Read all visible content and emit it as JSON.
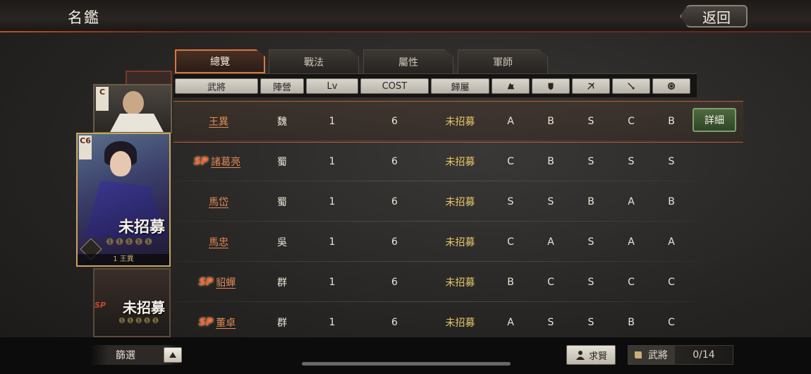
{
  "header": {
    "title": "名鑑",
    "back_label": "返回"
  },
  "tabs": [
    {
      "label": "總覽",
      "active": true
    },
    {
      "label": "戰法",
      "active": false
    },
    {
      "label": "屬性",
      "active": false
    },
    {
      "label": "軍師",
      "active": false
    }
  ],
  "columns": {
    "general": "武將",
    "faction": "陣營",
    "level": "Lv",
    "cost": "COST",
    "belong": "歸屬",
    "icons": [
      "cavalry-icon",
      "shield-icon",
      "bow-icon",
      "spear-icon",
      "wheel-icon"
    ]
  },
  "rows": [
    {
      "sp": "",
      "name": "王異",
      "faction": "魏",
      "lv": "1",
      "cost": "6",
      "status": "未招募",
      "apt": [
        "A",
        "B",
        "S",
        "C",
        "B"
      ],
      "selected": true
    },
    {
      "sp": "SP",
      "name": "諸葛亮",
      "faction": "蜀",
      "lv": "1",
      "cost": "6",
      "status": "未招募",
      "apt": [
        "C",
        "B",
        "S",
        "S",
        "S"
      ],
      "selected": false
    },
    {
      "sp": "",
      "name": "馬岱",
      "faction": "蜀",
      "lv": "1",
      "cost": "6",
      "status": "未招募",
      "apt": [
        "S",
        "S",
        "B",
        "A",
        "B"
      ],
      "selected": false
    },
    {
      "sp": "",
      "name": "馬忠",
      "faction": "吳",
      "lv": "1",
      "cost": "6",
      "status": "未招募",
      "apt": [
        "C",
        "A",
        "S",
        "A",
        "A"
      ],
      "selected": false
    },
    {
      "sp": "SP",
      "name": "貂蟬",
      "faction": "群",
      "lv": "1",
      "cost": "6",
      "status": "未招募",
      "apt": [
        "B",
        "C",
        "S",
        "C",
        "C"
      ],
      "selected": false
    },
    {
      "sp": "SP",
      "name": "董卓",
      "faction": "群",
      "lv": "1",
      "cost": "6",
      "status": "未招募",
      "apt": [
        "A",
        "S",
        "S",
        "B",
        "C"
      ],
      "selected": false
    }
  ],
  "detail_label": "詳細",
  "cards": {
    "main_grade": "C6",
    "upper_grade": "C",
    "main_status": "未招募",
    "main_caption": "1 王異",
    "low_status": "未招募",
    "low_sp": "SP",
    "faction_seal": "魏"
  },
  "footer": {
    "filter_label": "篩選",
    "seek_label": "求賢",
    "general_label": "武將",
    "general_count": "0/14"
  }
}
